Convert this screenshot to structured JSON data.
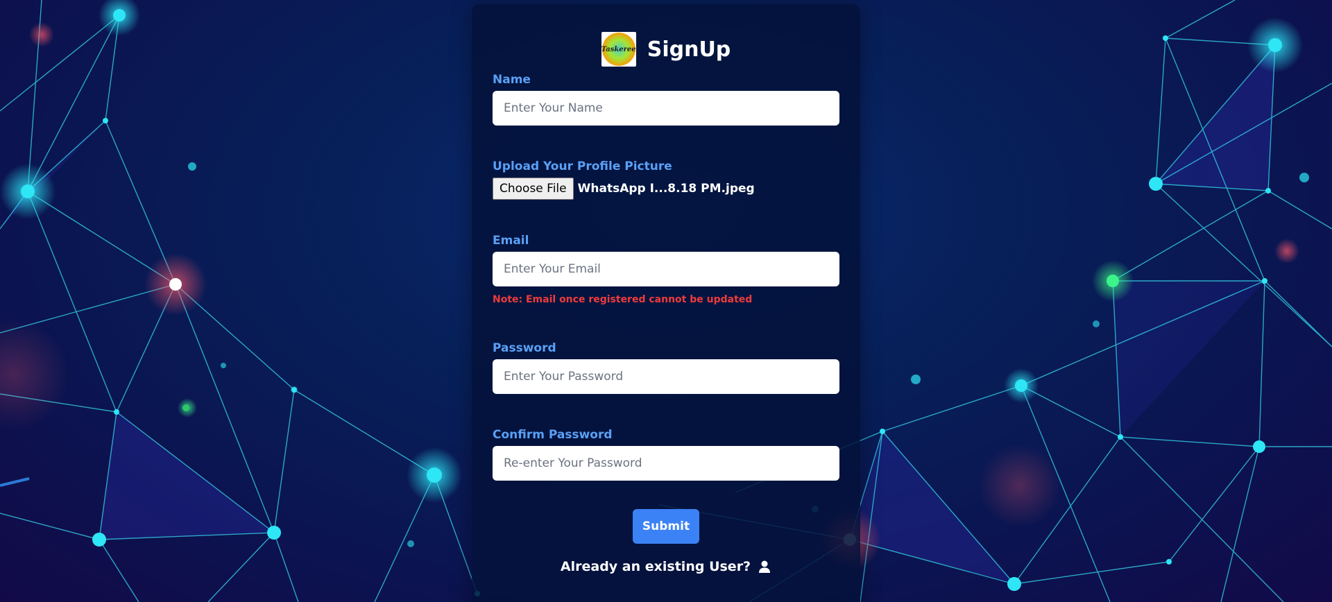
{
  "form": {
    "title": "SignUp",
    "logo_text": "Taskeree",
    "name_label": "Name",
    "name_placeholder": "Enter Your Name",
    "picture_label": "Upload Your Profile Picture",
    "file_button_label": "Choose File",
    "file_name": "WhatsApp I...8.18 PM.jpeg",
    "email_label": "Email",
    "email_placeholder": "Enter Your Email",
    "email_note": "Note: Email once registered cannot be updated",
    "password_label": "Password",
    "password_placeholder": "Enter Your Password",
    "confirm_label": "Confirm Password",
    "confirm_placeholder": "Re-enter Your Password",
    "submit_label": "Submit",
    "existing_user_text": "Already an existing User?",
    "existing_user_icon": "user-icon"
  },
  "colors": {
    "label": "#5aa0f5",
    "note": "#ef3b3b",
    "submit": "#3b82f6",
    "node": "#2ee6f5"
  }
}
